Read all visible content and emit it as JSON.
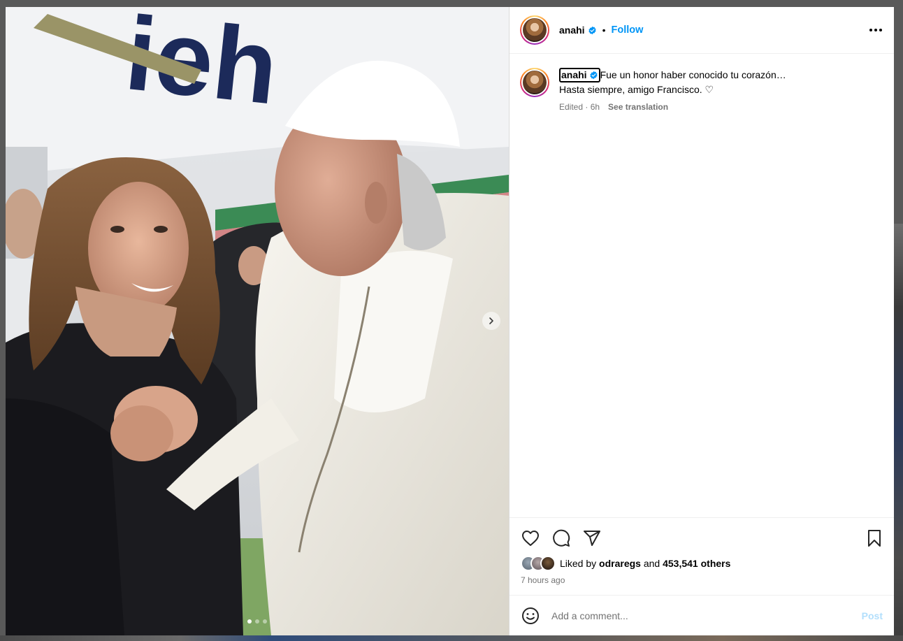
{
  "post": {
    "username": "anahi",
    "follow_label": "Follow",
    "separator": "•",
    "caption_username": "anahi",
    "caption_line1": "Fue un honor haber conocido tu corazón…",
    "caption_line2": "Hasta siempre, amigo Francisco. ♡",
    "edited_meta": "Edited · 6h",
    "see_translation": "See translation",
    "liked_by_prefix": "Liked by",
    "liked_by_user": "odraregs",
    "liked_by_and": "and",
    "liked_by_others": "453,541 others",
    "time_ago": "7 hours ago"
  },
  "media": {
    "slide_count": 3,
    "active_slide": 1,
    "background_sign_text": "ieh"
  },
  "comment": {
    "placeholder": "Add a comment...",
    "post_label": "Post"
  },
  "icons": {
    "header_more": "more-horizontal-icon",
    "verified": "verified-badge-icon",
    "like": "heart-icon",
    "comment": "comment-bubble-icon",
    "share": "paper-plane-icon",
    "save": "bookmark-icon",
    "emoji": "emoji-smile-icon",
    "next": "chevron-right-icon"
  },
  "colors": {
    "link_blue": "#0095f6",
    "verified_blue": "#0095f6",
    "post_disabled": "#b2dffc",
    "muted_text": "#737373"
  }
}
